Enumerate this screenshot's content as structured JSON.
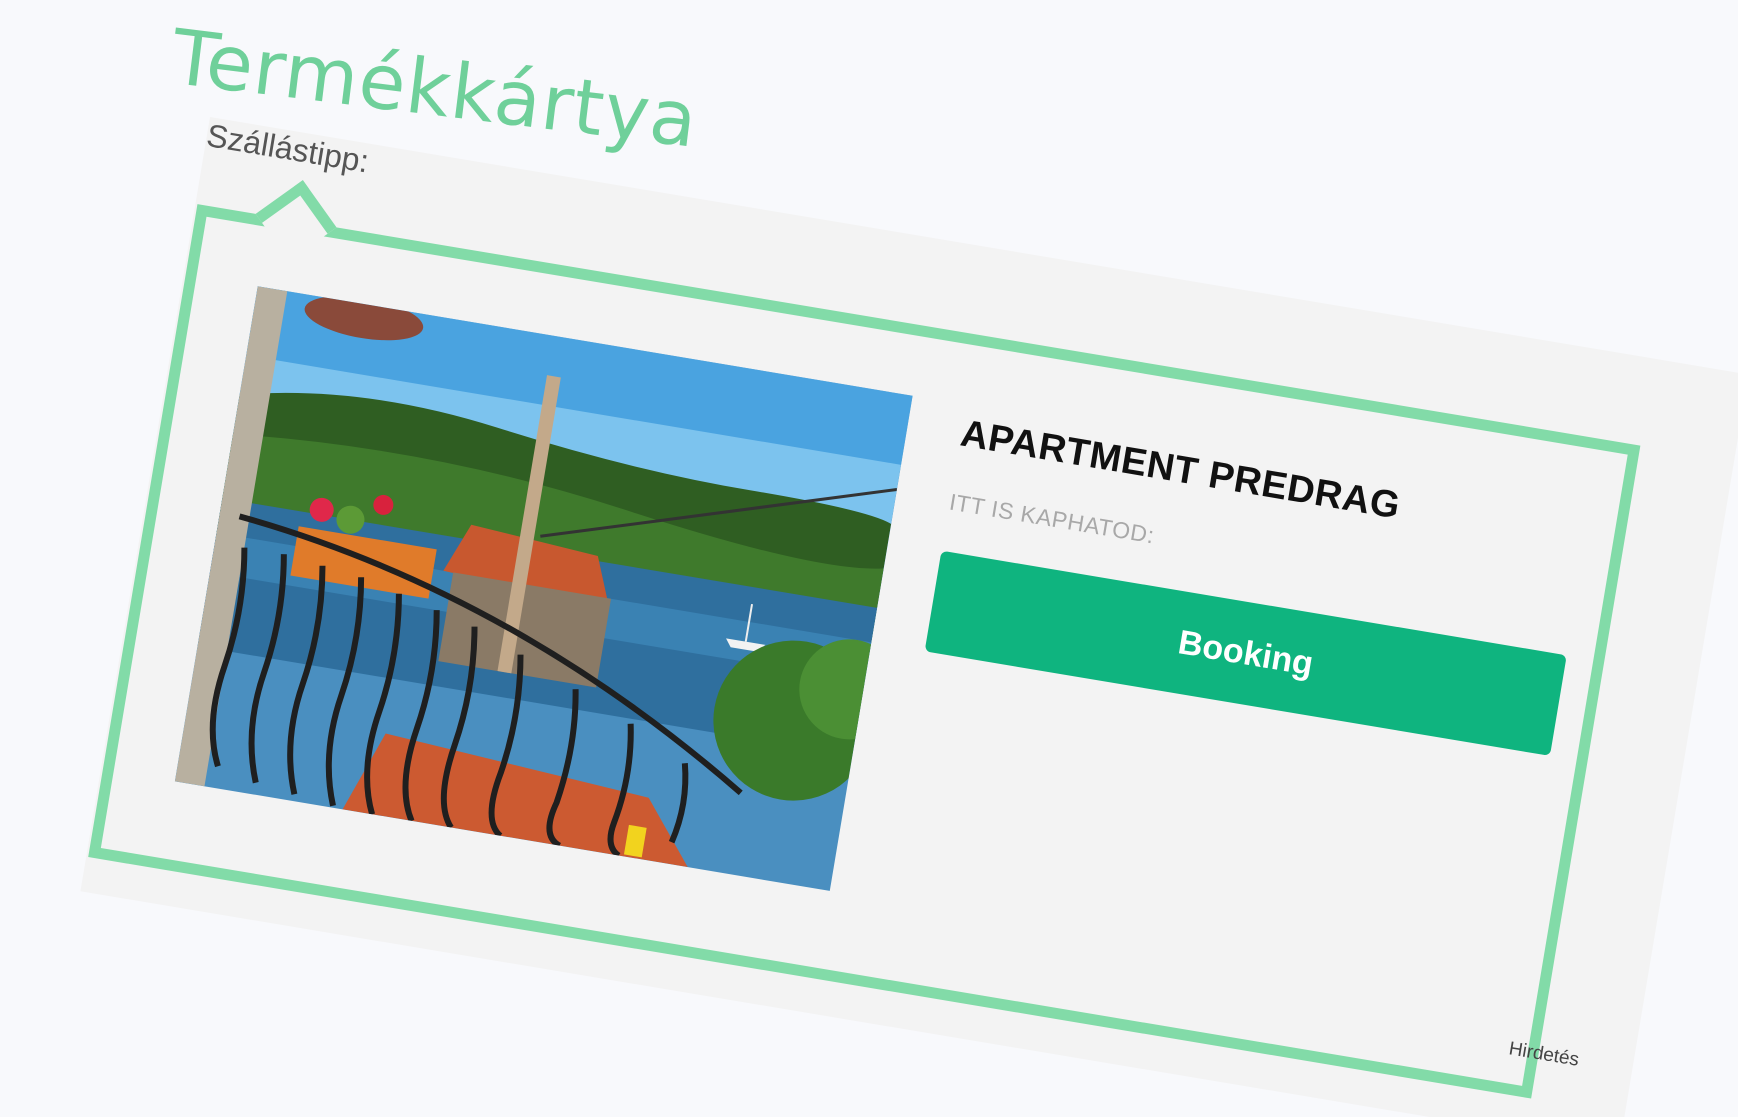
{
  "overlay": {
    "title": "Termékkártya"
  },
  "card": {
    "section_label": "Szállástipp:",
    "title": "APARTMENT PREDRAG",
    "subtitle": "ITT IS KAPHATOD:",
    "button_label": "Booking",
    "ad_label": "Hirdetés"
  },
  "colors": {
    "accent_green": "#82dba8",
    "button_green": "#0fb47f",
    "overlay_text": "#6fd09a"
  }
}
